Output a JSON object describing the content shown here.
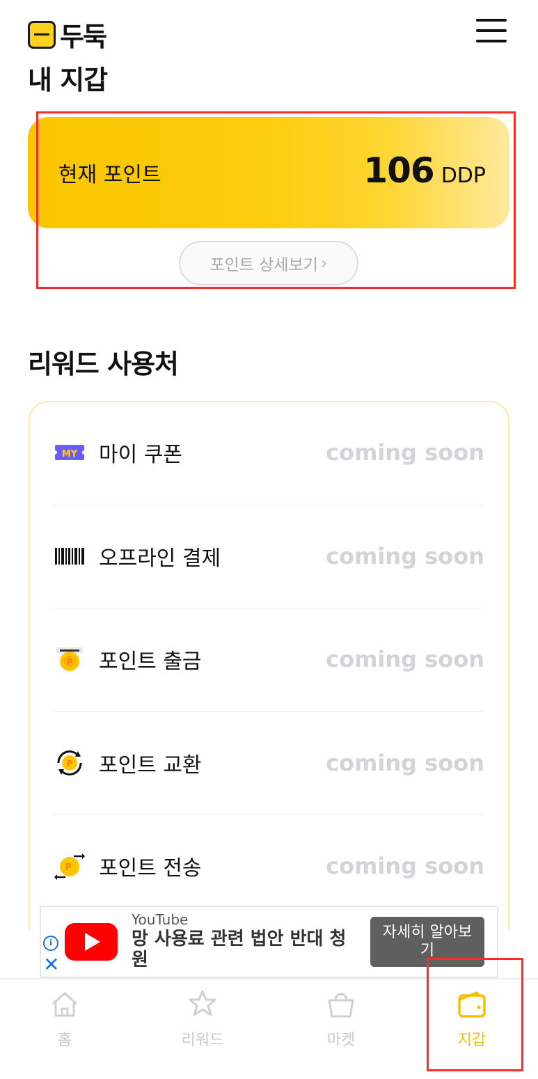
{
  "header": {
    "logo_text": "두둑",
    "menu_icon": "hamburger-menu-icon"
  },
  "page_title": "내 지갑",
  "points": {
    "label": "현재 포인트",
    "value": "106",
    "unit": "DDP",
    "detail_button": "포인트 상세보기"
  },
  "rewards": {
    "title": "리워드 사용처",
    "items": [
      {
        "label": "마이 쿠폰",
        "status": "coming soon",
        "icon": "my-coupon-icon"
      },
      {
        "label": "오프라인 결제",
        "status": "coming soon",
        "icon": "barcode-icon"
      },
      {
        "label": "포인트 출금",
        "status": "coming soon",
        "icon": "coin-withdraw-icon"
      },
      {
        "label": "포인트 교환",
        "status": "coming soon",
        "icon": "coin-exchange-icon"
      },
      {
        "label": "포인트 전송",
        "status": "coming soon",
        "icon": "coin-transfer-icon"
      }
    ]
  },
  "ad": {
    "source": "YouTube",
    "title": "망 사용료 관련 법안 반대 청원",
    "cta": "자세히 알아보기"
  },
  "bottom_nav": [
    {
      "label": "홈",
      "icon": "home-icon",
      "active": false
    },
    {
      "label": "리워드",
      "icon": "star-icon",
      "active": false
    },
    {
      "label": "마켓",
      "icon": "shopping-bag-icon",
      "active": false
    },
    {
      "label": "지갑",
      "icon": "wallet-icon",
      "active": true
    }
  ],
  "colors": {
    "accent": "#ffd21e",
    "active_nav": "#f2c200",
    "highlight": "#ff2a2a"
  }
}
